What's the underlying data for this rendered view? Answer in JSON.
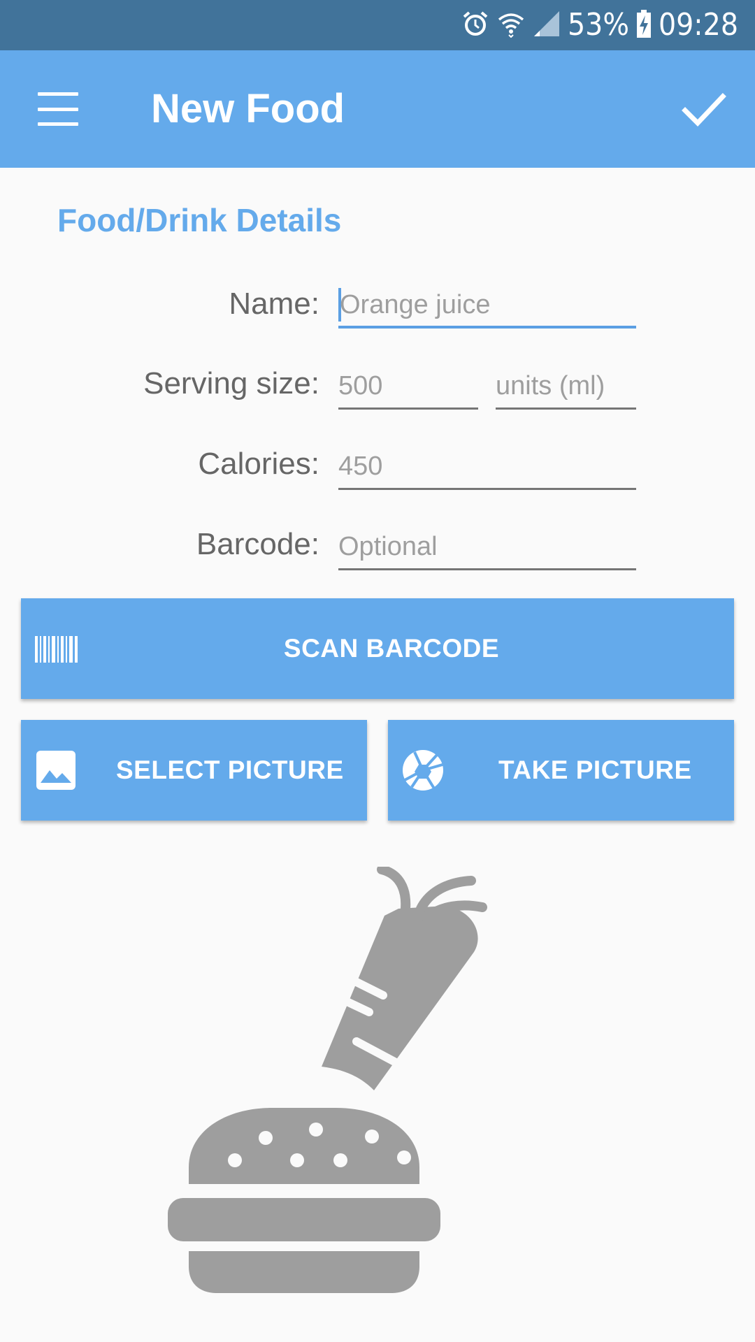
{
  "status_bar": {
    "battery": "53%",
    "time": "09:28",
    "icons": [
      "alarm-icon",
      "wifi-icon",
      "signal-icon",
      "battery-charging-icon"
    ]
  },
  "app_bar": {
    "title": "New Food",
    "menu_icon": "hamburger-menu-icon",
    "confirm_icon": "check-icon"
  },
  "form": {
    "section_title": "Food/Drink Details",
    "name": {
      "label": "Name:",
      "value": "",
      "placeholder": "Orange juice"
    },
    "serving_size": {
      "label": "Serving size:",
      "value": "",
      "placeholder": "500",
      "units_placeholder": "units (ml)"
    },
    "calories": {
      "label": "Calories:",
      "value": "",
      "placeholder": "450"
    },
    "barcode": {
      "label": "Barcode:",
      "value": "",
      "placeholder": "Optional"
    }
  },
  "buttons": {
    "scan_barcode": "SCAN BARCODE",
    "select_picture": "SELECT PICTURE",
    "take_picture": "TAKE PICTURE"
  },
  "colors": {
    "status_bar": "#41739a",
    "primary": "#64aaeb",
    "accent_focus": "#5b9fe3",
    "illustration": "#9e9e9e",
    "background": "#fafafa"
  },
  "illustration": "burger-carrot-icon"
}
